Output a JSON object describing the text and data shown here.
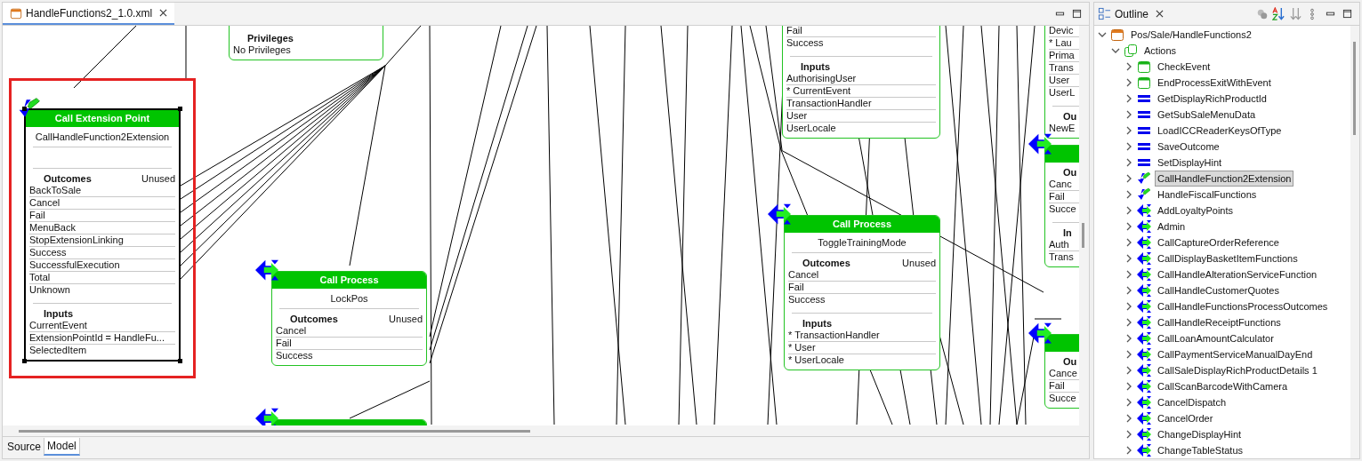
{
  "editor": {
    "tab": {
      "title": "HandleFunctions2_1.0.xml"
    },
    "nodes": [
      {
        "kind": "plain",
        "selected": false,
        "sections": [
          {
            "heading": "Privileges",
            "rows": [
              "No Privileges"
            ]
          }
        ]
      },
      {
        "kind": "extension",
        "title": "Call Extension Point",
        "name": "CallHandleFunction2Extension",
        "selected": true,
        "sections": [
          {
            "heading": "Outcomes",
            "note": "Unused",
            "rows": [
              "BackToSale",
              "Cancel",
              "Fail",
              "MenuBack",
              "StopExtensionLinking",
              "Success",
              "SuccessfulExecution",
              "Total",
              "Unknown"
            ]
          },
          {
            "heading": "Inputs",
            "rows": [
              "CurrentEvent",
              "ExtensionPointId = HandleFu...",
              "SelectedItem"
            ]
          }
        ]
      },
      {
        "kind": "process",
        "title": "Call Process",
        "name": "LockPos",
        "selected": false,
        "sections": [
          {
            "heading": "Outcomes",
            "note": "Unused",
            "rows": [
              "Cancel",
              "Fail",
              "Success"
            ]
          }
        ]
      },
      {
        "kind": "plain",
        "selected": false,
        "sections": [
          {
            "rows": [
              "Fail",
              "Success"
            ]
          },
          {
            "heading": "Inputs",
            "rows": [
              "AuthorisingUser",
              "* CurrentEvent",
              "TransactionHandler",
              "User",
              "UserLocale"
            ]
          }
        ]
      },
      {
        "kind": "process",
        "title": "Call Process",
        "name": "ToggleTrainingMode",
        "selected": false,
        "sections": [
          {
            "heading": "Outcomes",
            "note": "Unused",
            "rows": [
              "Cancel",
              "Fail",
              "Success"
            ]
          },
          {
            "heading": "Inputs",
            "rows": [
              "* TransactionHandler",
              "* User",
              "* UserLocale"
            ]
          }
        ]
      },
      {
        "kind": "plain",
        "selected": false,
        "sections": [
          {
            "rows": [
              "Devic",
              "* Lau",
              "Prima",
              "Trans",
              "User",
              "UserL"
            ]
          },
          {
            "heading": "Ou",
            "rows": [
              "NewE"
            ]
          }
        ]
      },
      {
        "kind": "process",
        "selected": false,
        "sections": [
          {
            "heading": "Ou",
            "rows": [
              "Canc",
              "Fail",
              "Succe"
            ]
          },
          {
            "heading": "In",
            "rows": [
              "Auth",
              "Trans"
            ]
          }
        ]
      },
      {
        "kind": "process",
        "selected": false,
        "sections": [
          {
            "heading": "Ou",
            "rows": [
              "Cance",
              "Fail",
              "Succe"
            ]
          }
        ]
      },
      {
        "kind": "process",
        "selected": false
      }
    ],
    "bottom_tabs": [
      {
        "label": "Source",
        "selected": false
      },
      {
        "label": "Model",
        "selected": true
      }
    ]
  },
  "outline": {
    "title": "Outline",
    "tree": [
      {
        "label": "Pos/Sale/HandleFunctions2",
        "kind": "file",
        "expanded": true,
        "selected": false,
        "children": [
          {
            "label": "Actions",
            "kind": "group",
            "expanded": true,
            "selected": false,
            "children": [
              {
                "label": "CheckEvent",
                "kind": "ui",
                "expanded": false,
                "selected": false
              },
              {
                "label": "EndProcessExitWithEvent",
                "kind": "ui",
                "expanded": false,
                "selected": false
              },
              {
                "label": "GetDisplayRichProductId",
                "kind": "method",
                "expanded": false,
                "selected": false
              },
              {
                "label": "GetSubSaleMenuData",
                "kind": "method",
                "expanded": false,
                "selected": false
              },
              {
                "label": "LoadICCReaderKeysOfType",
                "kind": "method",
                "expanded": false,
                "selected": false
              },
              {
                "label": "SaveOutcome",
                "kind": "method",
                "expanded": false,
                "selected": false
              },
              {
                "label": "SetDisplayHint",
                "kind": "method",
                "expanded": false,
                "selected": false
              },
              {
                "label": "CallHandleFunction2Extension",
                "kind": "extension",
                "expanded": false,
                "selected": true
              },
              {
                "label": "HandleFiscalFunctions",
                "kind": "extension",
                "expanded": false,
                "selected": false
              },
              {
                "label": "AddLoyaltyPoints",
                "kind": "call",
                "expanded": false,
                "selected": false
              },
              {
                "label": "Admin",
                "kind": "call",
                "expanded": false,
                "selected": false
              },
              {
                "label": "CallCaptureOrderReference",
                "kind": "call",
                "expanded": false,
                "selected": false
              },
              {
                "label": "CallDisplayBasketItemFunctions",
                "kind": "call",
                "expanded": false,
                "selected": false
              },
              {
                "label": "CallHandleAlterationServiceFunction",
                "kind": "call",
                "expanded": false,
                "selected": false
              },
              {
                "label": "CallHandleCustomerQuotes",
                "kind": "call",
                "expanded": false,
                "selected": false
              },
              {
                "label": "CallHandleFunctionsProcessOutcomes",
                "kind": "call",
                "expanded": false,
                "selected": false
              },
              {
                "label": "CallHandleReceiptFunctions",
                "kind": "call",
                "expanded": false,
                "selected": false
              },
              {
                "label": "CallLoanAmountCalculator",
                "kind": "call",
                "expanded": false,
                "selected": false
              },
              {
                "label": "CallPaymentServiceManualDayEnd",
                "kind": "call",
                "expanded": false,
                "selected": false
              },
              {
                "label": "CallSaleDisplayRichProductDetails 1",
                "kind": "call",
                "expanded": false,
                "selected": false
              },
              {
                "label": "CallScanBarcodeWithCamera",
                "kind": "call",
                "expanded": false,
                "selected": false
              },
              {
                "label": "CancelDispatch",
                "kind": "call",
                "expanded": false,
                "selected": false
              },
              {
                "label": "CancelOrder",
                "kind": "call",
                "expanded": false,
                "selected": false
              },
              {
                "label": "ChangeDisplayHint",
                "kind": "call",
                "expanded": false,
                "selected": false
              },
              {
                "label": "ChangeTableStatus",
                "kind": "call",
                "expanded": false,
                "selected": false
              }
            ]
          }
        ]
      }
    ]
  }
}
